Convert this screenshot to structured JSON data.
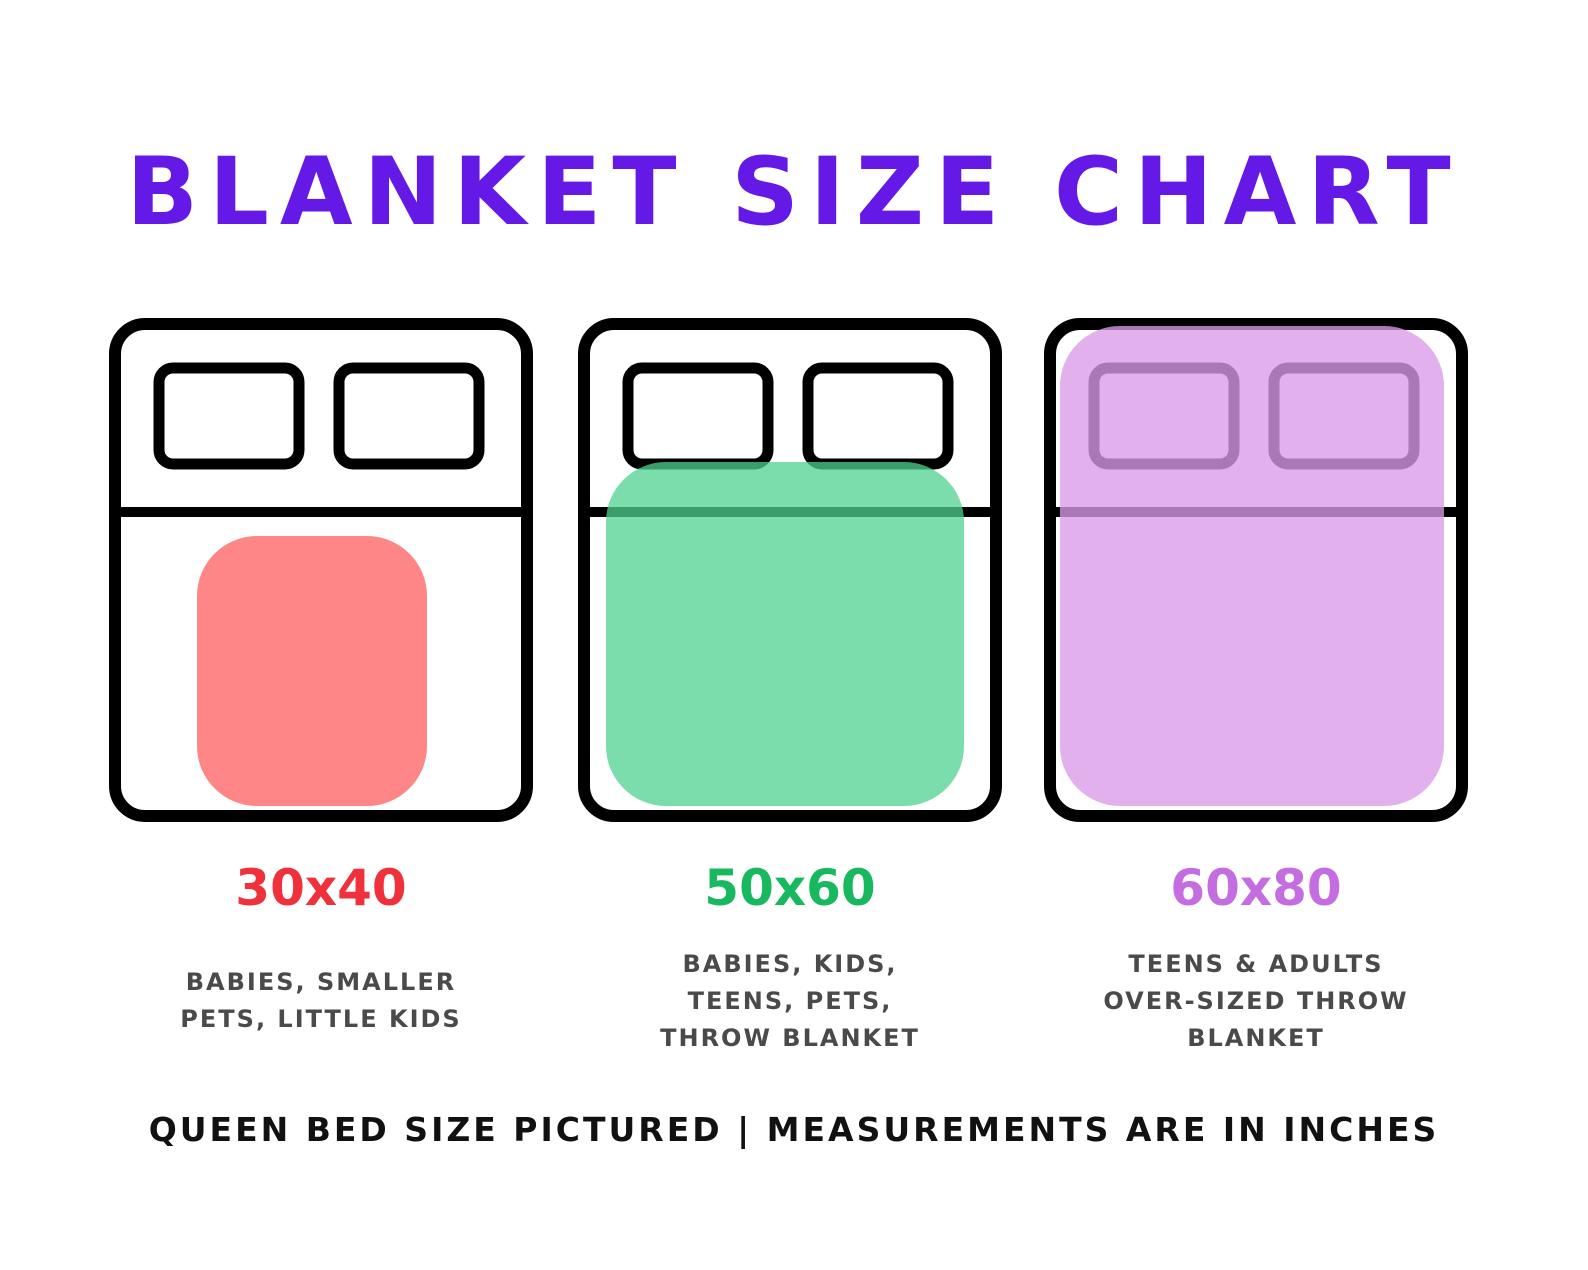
{
  "title": "BLANKET SIZE CHART",
  "colors": {
    "title": "#6419e6",
    "outline": "#000000",
    "small_blanket": "#ff6b6b",
    "medium_blanket": "#4fd18f",
    "large_blanket": "#d99ae8",
    "small_label": "#f0303a",
    "medium_label": "#18b85f",
    "large_label": "#c46de0",
    "description": "#4a4a4a"
  },
  "sizes": [
    {
      "label": "30x40",
      "description_lines": [
        "BABIES, SMALLER",
        "PETS, LITTLE KIDS"
      ],
      "icon": "bed-icon"
    },
    {
      "label": "50x60",
      "description_lines": [
        "BABIES, KIDS,",
        "TEENS, PETS,",
        "THROW BLANKET"
      ],
      "icon": "bed-icon"
    },
    {
      "label": "60x80",
      "description_lines": [
        "TEENS & ADULTS",
        "OVER-SIZED THROW",
        "BLANKET"
      ],
      "icon": "bed-icon"
    }
  ],
  "footer": "QUEEN BED SIZE PICTURED | MEASUREMENTS ARE IN INCHES"
}
